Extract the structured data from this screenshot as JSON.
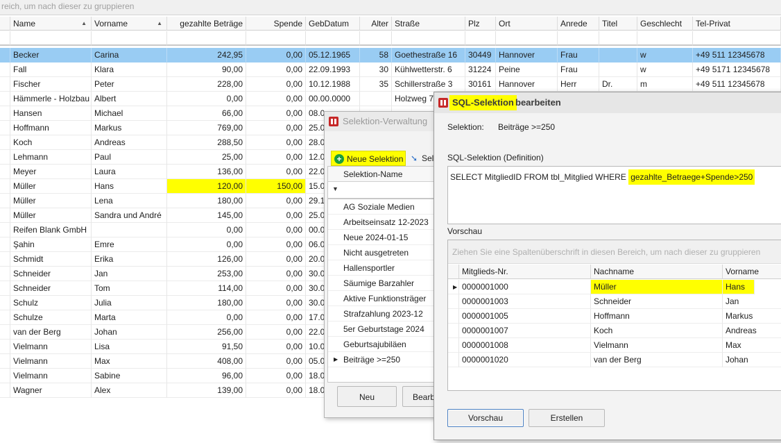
{
  "main": {
    "group_hint": "reich, um nach dieser zu gruppieren",
    "columns": [
      "Name",
      "Vorname",
      "gezahlte Beträge",
      "Spende",
      "GebDatum",
      "Alter",
      "Straße",
      "Plz",
      "Ort",
      "Anrede",
      "Titel",
      "Geschlecht",
      "Tel-Privat"
    ],
    "rows": [
      [
        "Becker",
        "Carina",
        "242,95",
        "0,00",
        "05.12.1965",
        "58",
        "Goethestraße 16",
        "30449",
        "Hannover",
        "Frau",
        "",
        "w",
        "+49 511 12345678"
      ],
      [
        "Fall",
        "Klara",
        "90,00",
        "0,00",
        "22.09.1993",
        "30",
        "Kühlwetterstr. 6",
        "31224",
        "Peine",
        "Frau",
        "",
        "w",
        "+49 5171 12345678"
      ],
      [
        "Fischer",
        "Peter",
        "228,00",
        "0,00",
        "10.12.1988",
        "35",
        "Schillerstraße 3",
        "30161",
        "Hannover",
        "Herr",
        "Dr.",
        "m",
        "+49 511 12345678"
      ],
      [
        "Hämmerle - Holzbau",
        "Albert",
        "0,00",
        "0,00",
        "00.00.0000",
        "",
        "Holzweg 7",
        "",
        "",
        "",
        "",
        "",
        ""
      ],
      [
        "Hansen",
        "Michael",
        "66,00",
        "0,00",
        "08.0",
        "",
        "",
        "",
        "",
        "",
        "",
        "",
        ""
      ],
      [
        "Hoffmann",
        "Markus",
        "769,00",
        "0,00",
        "25.0",
        "",
        "",
        "",
        "",
        "",
        "",
        "",
        ""
      ],
      [
        "Koch",
        "Andreas",
        "288,50",
        "0,00",
        "28.0",
        "",
        "",
        "",
        "",
        "",
        "",
        "",
        ""
      ],
      [
        "Lehmann",
        "Paul",
        "25,00",
        "0,00",
        "12.0",
        "",
        "",
        "",
        "",
        "",
        "",
        "",
        ""
      ],
      [
        "Meyer",
        "Laura",
        "136,00",
        "0,00",
        "22.0",
        "",
        "",
        "",
        "",
        "",
        "",
        "",
        ""
      ],
      [
        "Müller",
        "Hans",
        "120,00",
        "150,00",
        "15.0",
        "",
        "",
        "",
        "",
        "",
        "",
        "",
        ""
      ],
      [
        "Müller",
        "Lena",
        "180,00",
        "0,00",
        "29.1",
        "",
        "",
        "",
        "",
        "",
        "",
        "",
        ""
      ],
      [
        "Müller",
        "Sandra und André",
        "145,00",
        "0,00",
        "25.0",
        "",
        "",
        "",
        "",
        "",
        "",
        "",
        ""
      ],
      [
        "Reifen Blank GmbH",
        "",
        "0,00",
        "0,00",
        "00.0",
        "",
        "",
        "",
        "",
        "",
        "",
        "",
        ""
      ],
      [
        "Şahin",
        "Emre",
        "0,00",
        "0,00",
        "06.0",
        "",
        "",
        "",
        "",
        "",
        "",
        "",
        ""
      ],
      [
        "Schmidt",
        "Erika",
        "126,00",
        "0,00",
        "20.0",
        "",
        "",
        "",
        "",
        "",
        "",
        "",
        ""
      ],
      [
        "Schneider",
        "Jan",
        "253,00",
        "0,00",
        "30.0",
        "",
        "",
        "",
        "",
        "",
        "",
        "",
        ""
      ],
      [
        "Schneider",
        "Tom",
        "114,00",
        "0,00",
        "30.0",
        "",
        "",
        "",
        "",
        "",
        "",
        "",
        ""
      ],
      [
        "Schulz",
        "Julia",
        "180,00",
        "0,00",
        "30.0",
        "",
        "",
        "",
        "",
        "",
        "",
        "",
        ""
      ],
      [
        "Schulze",
        "Marta",
        "0,00",
        "0,00",
        "17.0",
        "",
        "",
        "",
        "",
        "",
        "",
        "",
        ""
      ],
      [
        "van der Berg",
        "Johan",
        "256,00",
        "0,00",
        "22.0",
        "",
        "",
        "",
        "",
        "",
        "",
        "",
        ""
      ],
      [
        "Vielmann",
        "Lisa",
        "91,50",
        "0,00",
        "10.0",
        "",
        "",
        "",
        "",
        "",
        "",
        "",
        ""
      ],
      [
        "Vielmann",
        "Max",
        "408,00",
        "0,00",
        "05.0",
        "",
        "",
        "",
        "",
        "",
        "",
        "",
        ""
      ],
      [
        "Vielmann",
        "Sabine",
        "96,00",
        "0,00",
        "18.0",
        "",
        "",
        "",
        "",
        "",
        "",
        "",
        ""
      ],
      [
        "Wagner",
        "Alex",
        "139,00",
        "0,00",
        "18.0",
        "",
        "",
        "",
        "",
        "",
        "",
        "",
        ""
      ]
    ],
    "selected_row": 0,
    "highlight_color": "#ffff00",
    "selection_color": "#99ccf3"
  },
  "verwaltung": {
    "title": "Selektion-Verwaltung",
    "btn_neue": "Neue Selektion",
    "btn_sele": "Sele",
    "col_header": "Selektion-Name",
    "items": [
      "AG Soziale Medien",
      "Arbeitseinsatz 12-2023",
      "Neue 2024-01-15",
      "Nicht ausgetreten",
      "Hallensportler",
      "Säumige Barzahler",
      "Aktive Funktionsträger",
      "Strafzahlung 2023-12",
      "5er Geburtstage 2024",
      "Geburtsajubiläen",
      "Beiträge >=250"
    ],
    "btn_neu": "Neu",
    "btn_bearb": "Bearb"
  },
  "sql": {
    "title_a": "SQL-Selektion",
    "title_b": "bearbeiten",
    "selektion_label": "Selektion:",
    "selektion_value": "Beiträge >=250",
    "definition_label": "SQL-Selektion (Definition)",
    "sql_prefix": "SELECT MitgliedID FROM tbl_Mitglied WHERE ",
    "sql_condition": "gezahlte_Betraege+Spende>250",
    "vorschau_label": "Vorschau",
    "group_hint": "Ziehen Sie eine Spaltenüberschrift in diesen Bereich, um nach dieser zu gruppieren",
    "columns": [
      "Mitglieds-Nr.",
      "Nachname",
      "Vorname"
    ],
    "rows": [
      [
        "0000001000",
        "Müller",
        "Hans"
      ],
      [
        "0000001003",
        "Schneider",
        "Jan"
      ],
      [
        "0000001005",
        "Hoffmann",
        "Markus"
      ],
      [
        "0000001007",
        "Koch",
        "Andreas"
      ],
      [
        "0000001008",
        "Vielmann",
        "Max"
      ],
      [
        "0000001020",
        "van der Berg",
        "Johan"
      ]
    ],
    "btn_vorschau": "Vorschau",
    "btn_erstellen": "Erstellen"
  }
}
